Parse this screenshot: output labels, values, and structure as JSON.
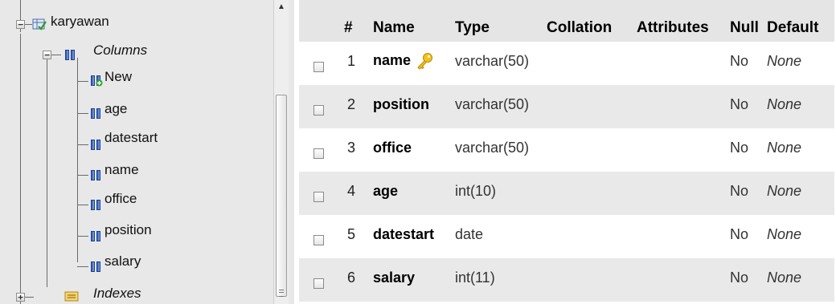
{
  "navigation": {
    "table": {
      "label": "karyawan",
      "expander": "−"
    },
    "columns_group": {
      "label": "Columns",
      "expander": "−"
    },
    "columns": [
      "New",
      "age",
      "datestart",
      "name",
      "office",
      "position",
      "salary"
    ],
    "indexes_group": {
      "label": "Indexes",
      "expander": "+"
    },
    "scroll_up_glyph": "▲"
  },
  "table": {
    "headers": [
      "#",
      "Name",
      "Type",
      "Collation",
      "Attributes",
      "Null",
      "Default"
    ],
    "rows": [
      {
        "num": "1",
        "name": "name",
        "primary_key": true,
        "type": "varchar(50)",
        "collation": "",
        "attributes": "",
        "null": "No",
        "default": "None"
      },
      {
        "num": "2",
        "name": "position",
        "primary_key": false,
        "type": "varchar(50)",
        "collation": "",
        "attributes": "",
        "null": "No",
        "default": "None"
      },
      {
        "num": "3",
        "name": "office",
        "primary_key": false,
        "type": "varchar(50)",
        "collation": "",
        "attributes": "",
        "null": "No",
        "default": "None"
      },
      {
        "num": "4",
        "name": "age",
        "primary_key": false,
        "type": "int(10)",
        "collation": "",
        "attributes": "",
        "null": "No",
        "default": "None"
      },
      {
        "num": "5",
        "name": "datestart",
        "primary_key": false,
        "type": "date",
        "collation": "",
        "attributes": "",
        "null": "No",
        "default": "None"
      },
      {
        "num": "6",
        "name": "salary",
        "primary_key": false,
        "type": "int(11)",
        "collation": "",
        "attributes": "",
        "null": "No",
        "default": "None"
      }
    ]
  },
  "colors": {
    "nav_bg": "#e8e8e8",
    "row_alt": "#e9e9e9",
    "header_bg": "#e5e5e5",
    "key_icon": "#f0b400"
  }
}
